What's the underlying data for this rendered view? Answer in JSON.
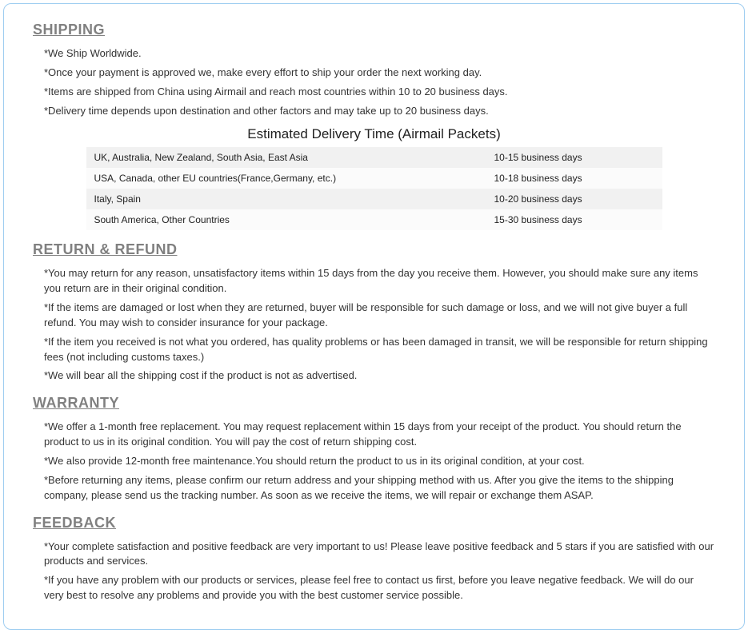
{
  "sections": {
    "shipping": {
      "title": "SHIPPING",
      "bullets": [
        "*We Ship Worldwide.",
        "*Once your payment is approved we, make every effort to ship your order the next working day.",
        "*Items are shipped from China using Airmail and reach most countries within 10 to 20 business days.",
        "*Delivery time depends upon destination and other factors and may take up to 20 business days."
      ],
      "table_title": "Estimated Delivery Time (Airmail Packets)",
      "table": [
        {
          "region": "UK, Australia, New Zealand, South Asia, East Asia",
          "time": "10-15 business days"
        },
        {
          "region": "USA, Canada, other EU countries(France,Germany, etc.)",
          "time": "10-18 business days"
        },
        {
          "region": "Italy, Spain",
          "time": "10-20 business days"
        },
        {
          "region": "South America, Other Countries",
          "time": "15-30 business days"
        }
      ]
    },
    "return": {
      "title": "RETURN & REFUND",
      "bullets": [
        "*You may return for any reason, unsatisfactory items within 15 days from the day you receive them. However, you should make sure any items you return are in their original condition.",
        "*If the items are damaged or lost when they are returned, buyer will be responsible for such damage or loss, and we will not give buyer a full refund. You may wish to consider insurance for your package.",
        "*If the item you received is not what you ordered, has quality problems or has been damaged in transit, we will be responsible for return shipping fees (not including customs taxes.)",
        "*We will bear all the shipping cost if the product is not as advertised."
      ]
    },
    "warranty": {
      "title": "WARRANTY",
      "bullets": [
        "*We offer a 1-month free replacement.  You may request replacement within 15 days from your receipt of the product. You should return the product to us in its original condition. You will pay the cost of return shipping cost.",
        "*We also provide 12-month free maintenance.You should return the product to us in its original condition, at your cost.",
        "*Before returning any items, please confirm our return address and your shipping method with us. After you give the items to the shipping company, please send us the tracking number. As soon as we receive the items, we will repair or exchange them ASAP."
      ]
    },
    "feedback": {
      "title": "FEEDBACK",
      "bullets": [
        "*Your complete satisfaction and positive feedback are very important to us!  Please leave positive feedback and 5 stars if you are satisfied with our products and services.",
        "*If you have any problem with our products or services, please feel free to contact us first, before you leave negative feedback.  We will do our very best to resolve any problems and provide you with the best customer service possible."
      ]
    }
  }
}
